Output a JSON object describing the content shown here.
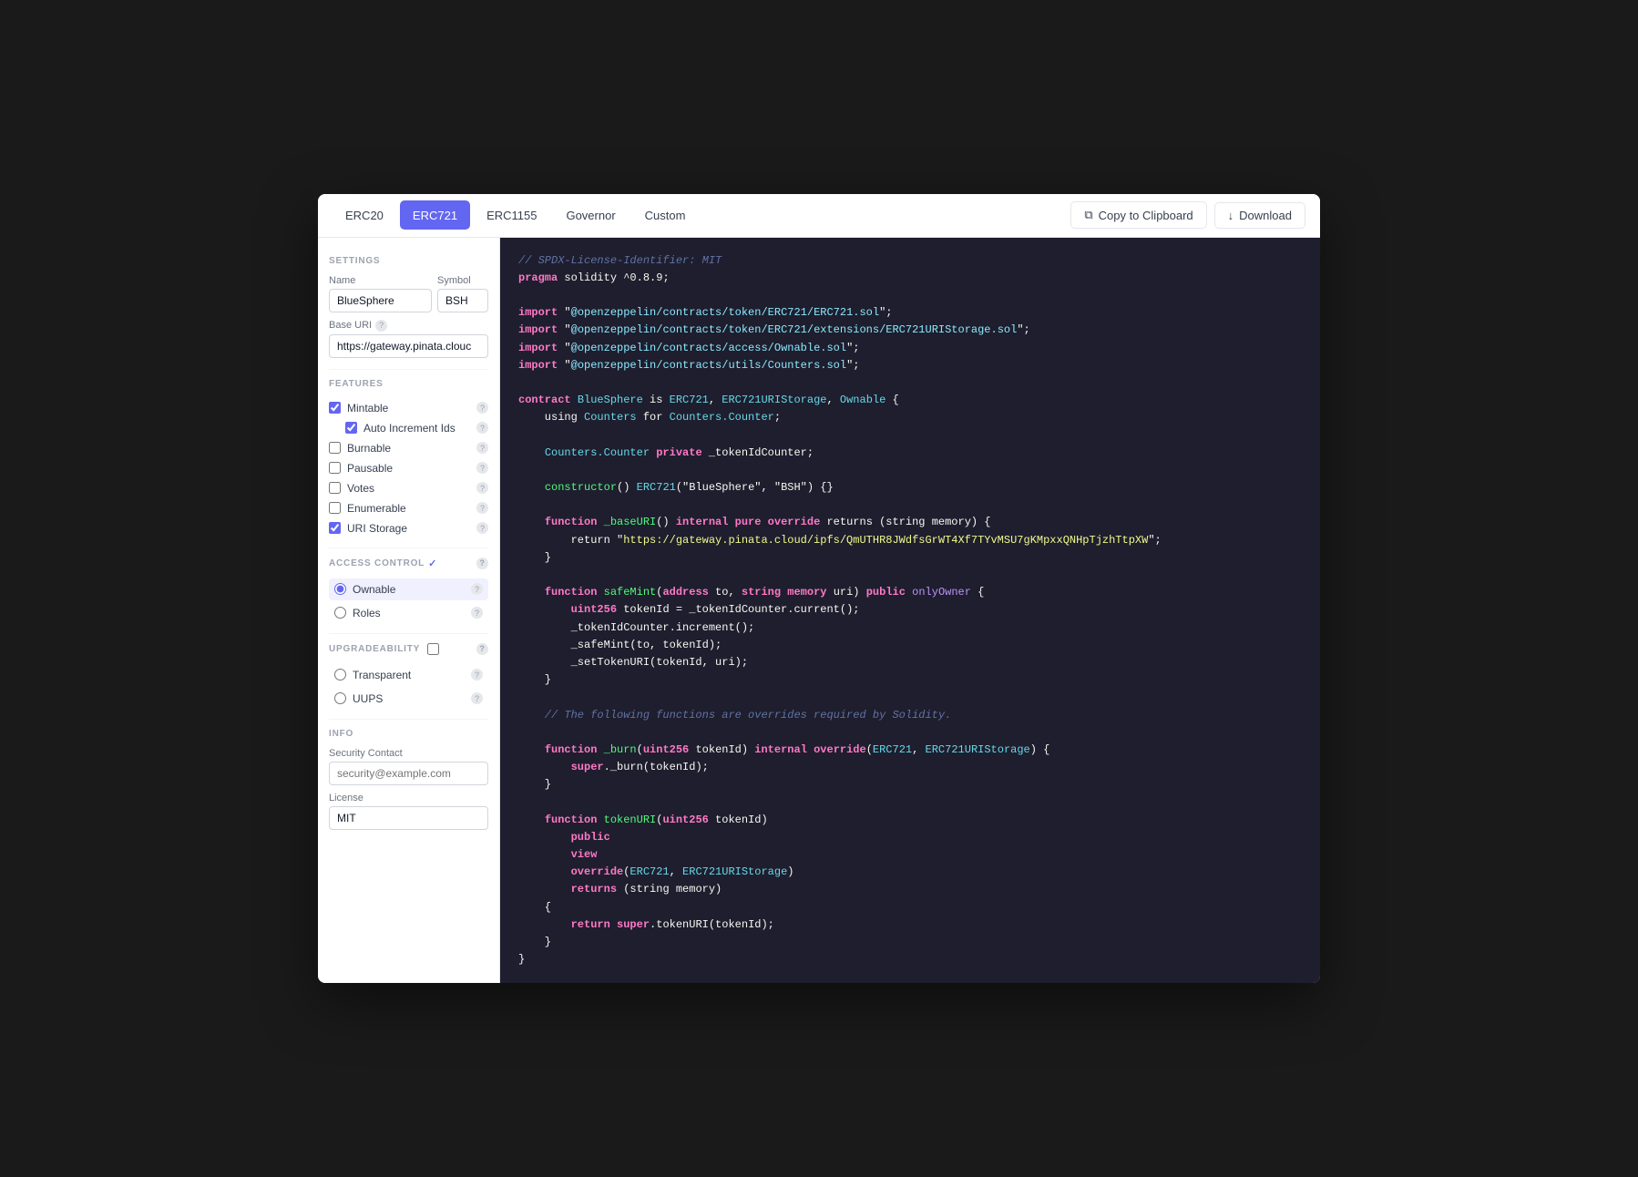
{
  "tabs": [
    {
      "id": "erc20",
      "label": "ERC20",
      "active": false
    },
    {
      "id": "erc721",
      "label": "ERC721",
      "active": true
    },
    {
      "id": "erc1155",
      "label": "ERC1155",
      "active": false
    },
    {
      "id": "governor",
      "label": "Governor",
      "active": false
    },
    {
      "id": "custom",
      "label": "Custom",
      "active": false
    }
  ],
  "actions": {
    "copy_label": "Copy to Clipboard",
    "download_label": "Download"
  },
  "settings": {
    "section_label": "SETTINGS",
    "name_label": "Name",
    "symbol_label": "Symbol",
    "name_value": "BlueSphere",
    "symbol_value": "BSH",
    "base_uri_label": "Base URI",
    "base_uri_value": "https://gateway.pinata.clouc"
  },
  "features": {
    "section_label": "FEATURES",
    "items": [
      {
        "id": "mintable",
        "label": "Mintable",
        "checked": true,
        "indent": false
      },
      {
        "id": "auto_increment",
        "label": "Auto Increment Ids",
        "checked": true,
        "indent": true
      },
      {
        "id": "burnable",
        "label": "Burnable",
        "checked": false,
        "indent": false
      },
      {
        "id": "pausable",
        "label": "Pausable",
        "checked": false,
        "indent": false
      },
      {
        "id": "votes",
        "label": "Votes",
        "checked": false,
        "indent": false
      },
      {
        "id": "enumerable",
        "label": "Enumerable",
        "checked": false,
        "indent": false
      },
      {
        "id": "uri_storage",
        "label": "URI Storage",
        "checked": true,
        "indent": false
      }
    ]
  },
  "access_control": {
    "section_label": "ACCESS CONTROL",
    "has_checkbox": true,
    "items": [
      {
        "id": "ownable",
        "label": "Ownable",
        "selected": true
      },
      {
        "id": "roles",
        "label": "Roles",
        "selected": false
      }
    ]
  },
  "upgradeability": {
    "section_label": "UPGRADEABILITY",
    "has_checkbox": true,
    "items": [
      {
        "id": "transparent",
        "label": "Transparent",
        "selected": false
      },
      {
        "id": "uups",
        "label": "UUPS",
        "selected": false
      }
    ]
  },
  "info": {
    "section_label": "INFO",
    "security_contact_label": "Security Contact",
    "security_contact_placeholder": "security@example.com",
    "security_contact_value": "",
    "license_label": "License",
    "license_value": "MIT"
  },
  "code": {
    "lines": [
      {
        "tokens": [
          {
            "cls": "c-comment",
            "text": "// SPDX-License-Identifier: MIT"
          }
        ]
      },
      {
        "tokens": [
          {
            "cls": "c-keyword",
            "text": "pragma"
          },
          {
            "cls": "c-white",
            "text": " solidity ^0.8.9;"
          }
        ]
      },
      {
        "tokens": []
      },
      {
        "tokens": [
          {
            "cls": "c-keyword",
            "text": "import"
          },
          {
            "cls": "c-white",
            "text": " \""
          },
          {
            "cls": "c-link",
            "text": "@openzeppelin/contracts/token/ERC721/ERC721.sol"
          },
          {
            "cls": "c-white",
            "text": "\";"
          }
        ]
      },
      {
        "tokens": [
          {
            "cls": "c-keyword",
            "text": "import"
          },
          {
            "cls": "c-white",
            "text": " \""
          },
          {
            "cls": "c-link",
            "text": "@openzeppelin/contracts/token/ERC721/extensions/ERC721URIStorage.sol"
          },
          {
            "cls": "c-white",
            "text": "\";"
          }
        ]
      },
      {
        "tokens": [
          {
            "cls": "c-keyword",
            "text": "import"
          },
          {
            "cls": "c-white",
            "text": " \""
          },
          {
            "cls": "c-link",
            "text": "@openzeppelin/contracts/access/Ownable.sol"
          },
          {
            "cls": "c-white",
            "text": "\";"
          }
        ]
      },
      {
        "tokens": [
          {
            "cls": "c-keyword",
            "text": "import"
          },
          {
            "cls": "c-white",
            "text": " \""
          },
          {
            "cls": "c-link",
            "text": "@openzeppelin/contracts/utils/Counters.sol"
          },
          {
            "cls": "c-white",
            "text": "\";"
          }
        ]
      },
      {
        "tokens": []
      },
      {
        "tokens": [
          {
            "cls": "c-keyword",
            "text": "contract"
          },
          {
            "cls": "c-white",
            "text": " "
          },
          {
            "cls": "c-type",
            "text": "BlueSphere"
          },
          {
            "cls": "c-white",
            "text": " is "
          },
          {
            "cls": "c-type",
            "text": "ERC721"
          },
          {
            "cls": "c-white",
            "text": ", "
          },
          {
            "cls": "c-type",
            "text": "ERC721URIStorage"
          },
          {
            "cls": "c-white",
            "text": ", "
          },
          {
            "cls": "c-type",
            "text": "Ownable"
          },
          {
            "cls": "c-white",
            "text": " {"
          }
        ]
      },
      {
        "tokens": [
          {
            "cls": "c-white",
            "text": "    using "
          },
          {
            "cls": "c-type",
            "text": "Counters"
          },
          {
            "cls": "c-white",
            "text": " for "
          },
          {
            "cls": "c-type",
            "text": "Counters.Counter"
          },
          {
            "cls": "c-white",
            "text": ";"
          }
        ]
      },
      {
        "tokens": []
      },
      {
        "tokens": [
          {
            "cls": "c-white",
            "text": "    "
          },
          {
            "cls": "c-type",
            "text": "Counters.Counter"
          },
          {
            "cls": "c-white",
            "text": " "
          },
          {
            "cls": "c-keyword",
            "text": "private"
          },
          {
            "cls": "c-white",
            "text": " _tokenIdCounter;"
          }
        ]
      },
      {
        "tokens": []
      },
      {
        "tokens": [
          {
            "cls": "c-white",
            "text": "    "
          },
          {
            "cls": "c-func",
            "text": "constructor"
          },
          {
            "cls": "c-white",
            "text": "() "
          },
          {
            "cls": "c-type",
            "text": "ERC721"
          },
          {
            "cls": "c-white",
            "text": "(\"BlueSphere\", \"BSH\") {}"
          }
        ]
      },
      {
        "tokens": []
      },
      {
        "tokens": [
          {
            "cls": "c-white",
            "text": "    "
          },
          {
            "cls": "c-keyword",
            "text": "function"
          },
          {
            "cls": "c-white",
            "text": " "
          },
          {
            "cls": "c-func",
            "text": "_baseURI"
          },
          {
            "cls": "c-white",
            "text": "() "
          },
          {
            "cls": "c-keyword",
            "text": "internal pure override"
          },
          {
            "cls": "c-white",
            "text": " returns (string memory) {"
          }
        ]
      },
      {
        "tokens": [
          {
            "cls": "c-white",
            "text": "        return \""
          },
          {
            "cls": "c-string",
            "text": "https://gateway.pinata.cloud/ipfs/QmUTHR8JWdfsGrWT4Xf7TYvMSU7gKMpxxQNHpTjzhTtpXW"
          },
          {
            "cls": "c-white",
            "text": "\";"
          }
        ]
      },
      {
        "tokens": [
          {
            "cls": "c-white",
            "text": "    }"
          }
        ]
      },
      {
        "tokens": []
      },
      {
        "tokens": [
          {
            "cls": "c-white",
            "text": "    "
          },
          {
            "cls": "c-keyword",
            "text": "function"
          },
          {
            "cls": "c-white",
            "text": " "
          },
          {
            "cls": "c-func",
            "text": "safeMint"
          },
          {
            "cls": "c-white",
            "text": "("
          },
          {
            "cls": "c-keyword",
            "text": "address"
          },
          {
            "cls": "c-white",
            "text": " to, "
          },
          {
            "cls": "c-keyword",
            "text": "string memory"
          },
          {
            "cls": "c-white",
            "text": " uri) "
          },
          {
            "cls": "c-keyword",
            "text": "public"
          },
          {
            "cls": "c-white",
            "text": " "
          },
          {
            "cls": "c-purple",
            "text": "onlyOwner"
          },
          {
            "cls": "c-white",
            "text": " {"
          }
        ]
      },
      {
        "tokens": [
          {
            "cls": "c-white",
            "text": "        "
          },
          {
            "cls": "c-keyword",
            "text": "uint256"
          },
          {
            "cls": "c-white",
            "text": " tokenId = _tokenIdCounter.current();"
          }
        ]
      },
      {
        "tokens": [
          {
            "cls": "c-white",
            "text": "        _tokenIdCounter.increment();"
          }
        ]
      },
      {
        "tokens": [
          {
            "cls": "c-white",
            "text": "        _safeMint(to, tokenId);"
          }
        ]
      },
      {
        "tokens": [
          {
            "cls": "c-white",
            "text": "        _setTokenURI(tokenId, uri);"
          }
        ]
      },
      {
        "tokens": [
          {
            "cls": "c-white",
            "text": "    }"
          }
        ]
      },
      {
        "tokens": []
      },
      {
        "tokens": [
          {
            "cls": "c-comment",
            "text": "    // The following functions are overrides required by Solidity."
          }
        ]
      },
      {
        "tokens": []
      },
      {
        "tokens": [
          {
            "cls": "c-white",
            "text": "    "
          },
          {
            "cls": "c-keyword",
            "text": "function"
          },
          {
            "cls": "c-white",
            "text": " "
          },
          {
            "cls": "c-func",
            "text": "_burn"
          },
          {
            "cls": "c-white",
            "text": "("
          },
          {
            "cls": "c-keyword",
            "text": "uint256"
          },
          {
            "cls": "c-white",
            "text": " tokenId) "
          },
          {
            "cls": "c-keyword",
            "text": "internal override"
          },
          {
            "cls": "c-white",
            "text": "("
          },
          {
            "cls": "c-type",
            "text": "ERC721"
          },
          {
            "cls": "c-white",
            "text": ", "
          },
          {
            "cls": "c-type",
            "text": "ERC721URIStorage"
          },
          {
            "cls": "c-white",
            "text": ") {"
          }
        ]
      },
      {
        "tokens": [
          {
            "cls": "c-white",
            "text": "        "
          },
          {
            "cls": "c-keyword",
            "text": "super"
          },
          {
            "cls": "c-white",
            "text": "._burn(tokenId);"
          }
        ]
      },
      {
        "tokens": [
          {
            "cls": "c-white",
            "text": "    }"
          }
        ]
      },
      {
        "tokens": []
      },
      {
        "tokens": [
          {
            "cls": "c-white",
            "text": "    "
          },
          {
            "cls": "c-keyword",
            "text": "function"
          },
          {
            "cls": "c-white",
            "text": " "
          },
          {
            "cls": "c-func",
            "text": "tokenURI"
          },
          {
            "cls": "c-white",
            "text": "("
          },
          {
            "cls": "c-keyword",
            "text": "uint256"
          },
          {
            "cls": "c-white",
            "text": " tokenId)"
          }
        ]
      },
      {
        "tokens": [
          {
            "cls": "c-white",
            "text": "        "
          },
          {
            "cls": "c-keyword",
            "text": "public"
          }
        ]
      },
      {
        "tokens": [
          {
            "cls": "c-white",
            "text": "        "
          },
          {
            "cls": "c-keyword",
            "text": "view"
          }
        ]
      },
      {
        "tokens": [
          {
            "cls": "c-white",
            "text": "        "
          },
          {
            "cls": "c-keyword",
            "text": "override"
          },
          {
            "cls": "c-white",
            "text": "("
          },
          {
            "cls": "c-type",
            "text": "ERC721"
          },
          {
            "cls": "c-white",
            "text": ", "
          },
          {
            "cls": "c-type",
            "text": "ERC721URIStorage"
          },
          {
            "cls": "c-white",
            "text": ")"
          }
        ]
      },
      {
        "tokens": [
          {
            "cls": "c-white",
            "text": "        "
          },
          {
            "cls": "c-keyword",
            "text": "returns"
          },
          {
            "cls": "c-white",
            "text": " (string memory)"
          }
        ]
      },
      {
        "tokens": [
          {
            "cls": "c-white",
            "text": "    {"
          }
        ]
      },
      {
        "tokens": [
          {
            "cls": "c-white",
            "text": "        "
          },
          {
            "cls": "c-keyword",
            "text": "return"
          },
          {
            "cls": "c-white",
            "text": " "
          },
          {
            "cls": "c-keyword",
            "text": "super"
          },
          {
            "cls": "c-white",
            "text": ".tokenURI(tokenId);"
          }
        ]
      },
      {
        "tokens": [
          {
            "cls": "c-white",
            "text": "    }"
          }
        ]
      },
      {
        "tokens": [
          {
            "cls": "c-white",
            "text": "}"
          }
        ]
      }
    ]
  }
}
